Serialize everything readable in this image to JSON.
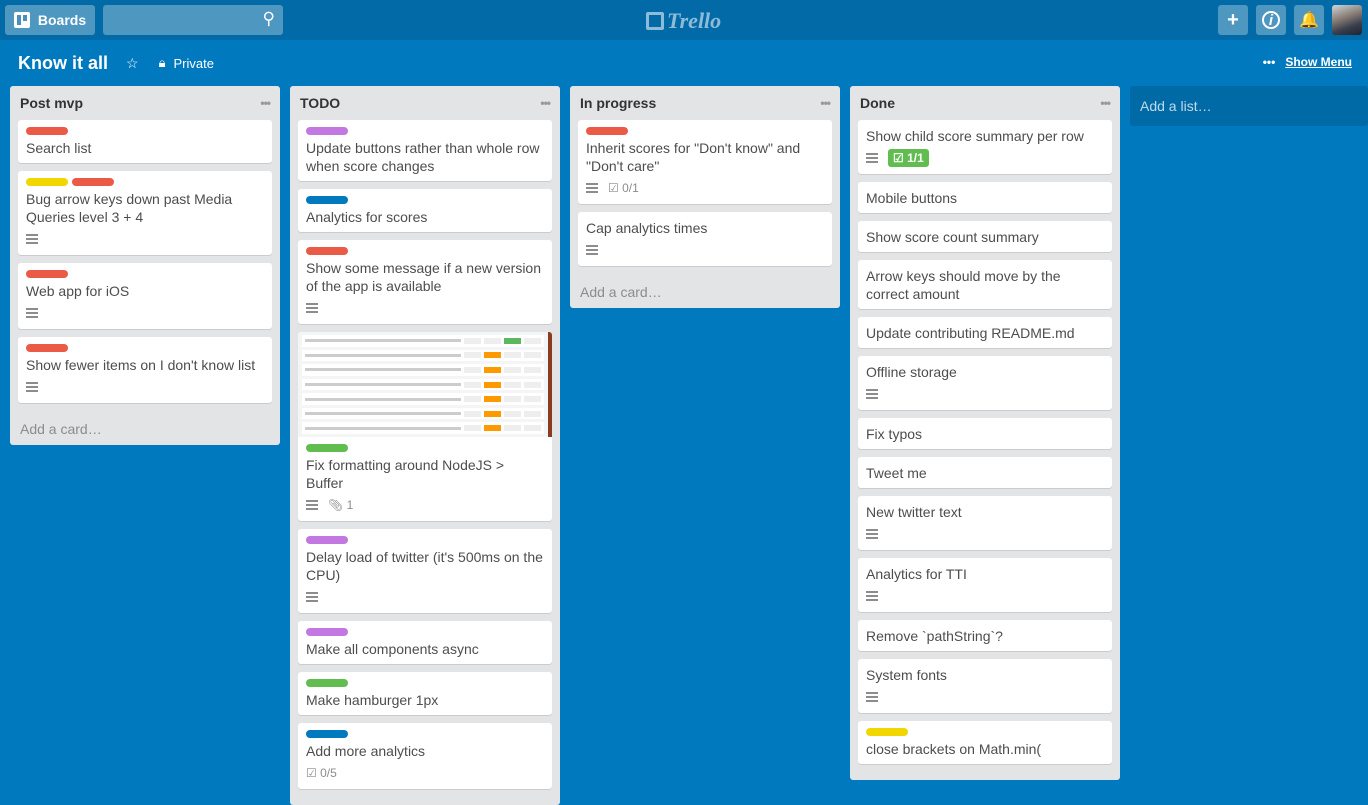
{
  "topbar": {
    "boards_label": "Boards",
    "search_placeholder": "",
    "logo_text": "Trello"
  },
  "board": {
    "title": "Know it all",
    "visibility": "Private",
    "show_menu": "Show Menu"
  },
  "label_colors": {
    "red": "#eb5a46",
    "yellow": "#f2d600",
    "purple": "#c377e0",
    "blue": "#0079bf",
    "green": "#61bd4f"
  },
  "lists": [
    {
      "name": "Post mvp",
      "add_card": "Add a card…",
      "cards": [
        {
          "labels": [
            "red"
          ],
          "title": "Search list"
        },
        {
          "labels": [
            "yellow",
            "red"
          ],
          "title": "Bug arrow keys down past Media Queries level 3 + 4",
          "desc": true
        },
        {
          "labels": [
            "red"
          ],
          "title": "Web app for iOS",
          "desc": true
        },
        {
          "labels": [
            "red"
          ],
          "title": "Show fewer items on I don't know list",
          "desc": true
        }
      ]
    },
    {
      "name": "TODO",
      "add_card": "",
      "cards": [
        {
          "labels": [
            "purple"
          ],
          "title": "Update buttons rather than whole row when score changes"
        },
        {
          "labels": [
            "blue"
          ],
          "title": "Analytics for scores"
        },
        {
          "labels": [
            "red"
          ],
          "title": "Show some message if a new version of the app is available",
          "desc": true
        },
        {
          "cover": true,
          "labels": [
            "green"
          ],
          "title": "Fix formatting around NodeJS > Buffer",
          "desc": true,
          "attachments": "1"
        },
        {
          "labels": [
            "purple"
          ],
          "title": "Delay load of twitter (it's 500ms on the CPU)",
          "desc": true
        },
        {
          "labels": [
            "purple"
          ],
          "title": "Make all components async"
        },
        {
          "labels": [
            "green"
          ],
          "title": "Make hamburger 1px"
        },
        {
          "labels": [
            "blue"
          ],
          "title": "Add more analytics",
          "checklist": "0/5"
        }
      ]
    },
    {
      "name": "In progress",
      "add_card": "Add a card…",
      "cards": [
        {
          "labels": [
            "red"
          ],
          "title": "Inherit scores for \"Don't know\" and \"Don't care\"",
          "desc": true,
          "checklist": "0/1"
        },
        {
          "labels": [],
          "title": "Cap analytics times",
          "desc": true
        }
      ]
    },
    {
      "name": "Done",
      "add_card": "",
      "cards": [
        {
          "labels": [],
          "title": "Show child score summary per row",
          "desc": true,
          "checklist": "1/1",
          "checklist_complete": true
        },
        {
          "labels": [],
          "title": "Mobile buttons"
        },
        {
          "labels": [],
          "title": "Show score count summary"
        },
        {
          "labels": [],
          "title": "Arrow keys should move by the correct amount"
        },
        {
          "labels": [],
          "title": "Update contributing README.md"
        },
        {
          "labels": [],
          "title": "Offline storage",
          "desc": true
        },
        {
          "labels": [],
          "title": "Fix typos"
        },
        {
          "labels": [],
          "title": "Tweet me"
        },
        {
          "labels": [],
          "title": "New twitter text",
          "desc": true
        },
        {
          "labels": [],
          "title": "Analytics for TTI",
          "desc": true
        },
        {
          "labels": [],
          "title": "Remove `pathString`?"
        },
        {
          "labels": [],
          "title": "System fonts",
          "desc": true
        },
        {
          "labels": [
            "yellow"
          ],
          "title": "close brackets on Math.min("
        }
      ]
    }
  ],
  "add_list": "Add a list…"
}
